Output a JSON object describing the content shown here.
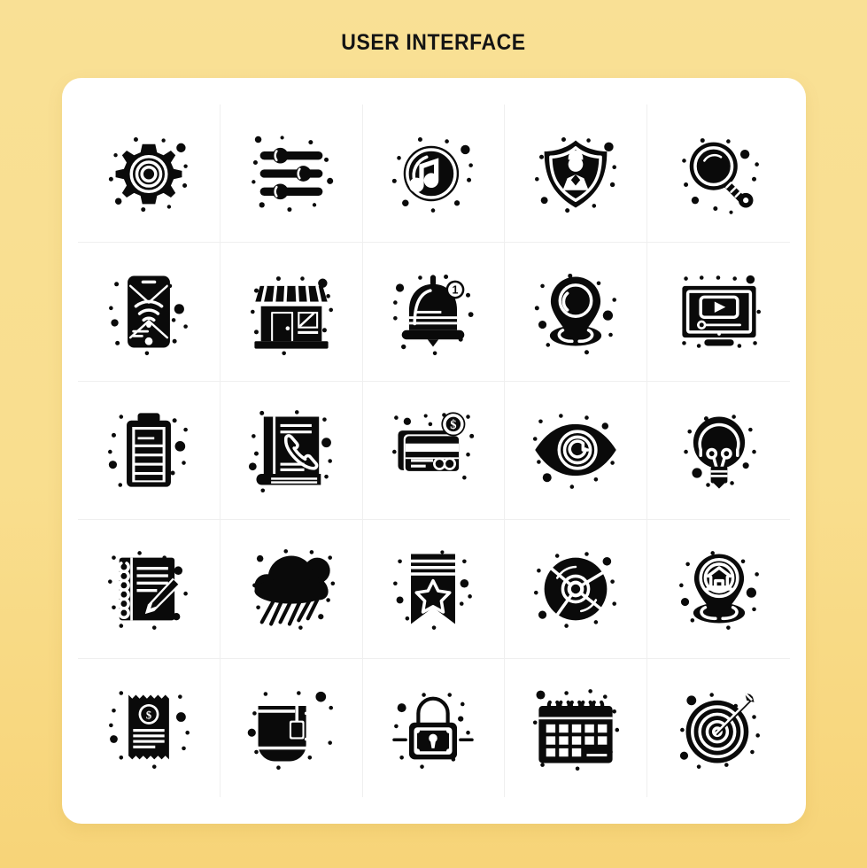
{
  "page": {
    "title": "USER INTERFACE",
    "background_color": "#F9DE8E",
    "card_color": "#FFFFFF",
    "icon_color": "#0A0A0A",
    "grid_line_color": "#EFEFEF"
  },
  "grid": {
    "columns": 5,
    "rows": 5,
    "total_icons": 25
  },
  "icons": [
    {
      "index": 1,
      "name": "gear-icon",
      "label": "Settings Gear"
    },
    {
      "index": 2,
      "name": "sliders-icon",
      "label": "Settings Sliders"
    },
    {
      "index": 3,
      "name": "music-note-icon",
      "label": "Music"
    },
    {
      "index": 4,
      "name": "shield-user-icon",
      "label": "Security Guard Shield"
    },
    {
      "index": 5,
      "name": "search-icon",
      "label": "Search"
    },
    {
      "index": 6,
      "name": "mobile-wifi-icon",
      "label": "Mobile WiFi"
    },
    {
      "index": 7,
      "name": "store-icon",
      "label": "Store"
    },
    {
      "index": 8,
      "name": "notification-bell-icon",
      "label": "Notification Bell",
      "badge": "1"
    },
    {
      "index": 9,
      "name": "location-pin-icon",
      "label": "Location Pin"
    },
    {
      "index": 10,
      "name": "video-player-icon",
      "label": "Video Player"
    },
    {
      "index": 11,
      "name": "battery-icon",
      "label": "Battery"
    },
    {
      "index": 12,
      "name": "phone-book-icon",
      "label": "Phone Book"
    },
    {
      "index": 13,
      "name": "credit-card-icon",
      "label": "Credit Card Payment"
    },
    {
      "index": 14,
      "name": "eye-icon",
      "label": "Eye View"
    },
    {
      "index": 15,
      "name": "light-bulb-icon",
      "label": "Idea Light Bulb"
    },
    {
      "index": 16,
      "name": "notepad-pencil-icon",
      "label": "Notepad with Pencil"
    },
    {
      "index": 17,
      "name": "rain-cloud-icon",
      "label": "Rain Cloud"
    },
    {
      "index": 18,
      "name": "bookmark-star-icon",
      "label": "Bookmark Star"
    },
    {
      "index": 19,
      "name": "compact-disc-icon",
      "label": "Compact Disc"
    },
    {
      "index": 20,
      "name": "home-location-icon",
      "label": "Home Location Pin"
    },
    {
      "index": 21,
      "name": "receipt-icon",
      "label": "Receipt Invoice"
    },
    {
      "index": 22,
      "name": "tea-cup-icon",
      "label": "Tea Cup"
    },
    {
      "index": 23,
      "name": "padlock-icon",
      "label": "Padlock Lock"
    },
    {
      "index": 24,
      "name": "calendar-icon",
      "label": "Calendar"
    },
    {
      "index": 25,
      "name": "target-arrow-icon",
      "label": "Target with Arrow"
    }
  ]
}
